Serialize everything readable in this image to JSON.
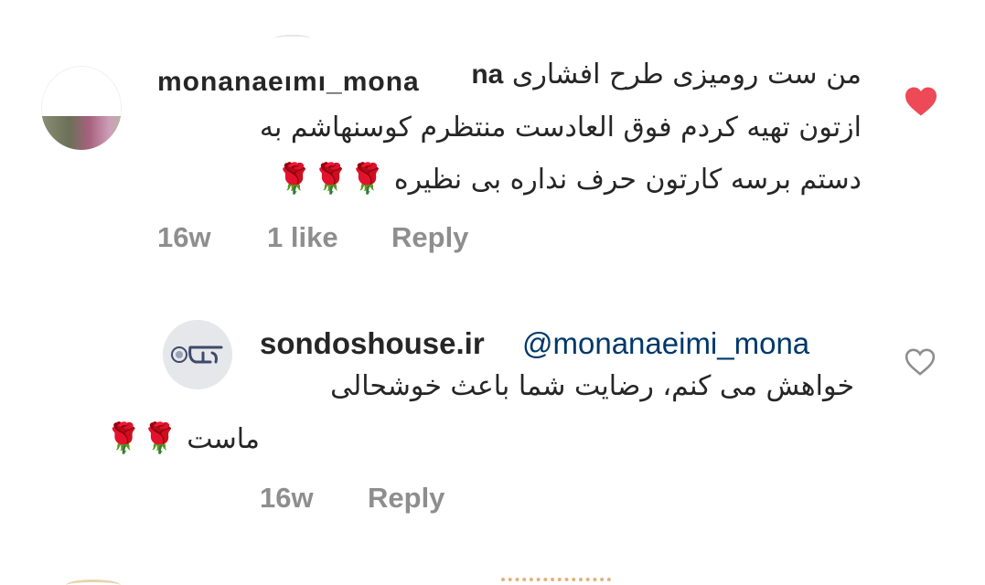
{
  "comment": {
    "username": "monanaeimi_mona",
    "username_inline_tail": "na",
    "lines": [
      "من ست رومیزی طرح افشاری",
      "ازتون تهیه کردم فوق العادست منتظرم کوسنهاشم به",
      "دستم برسه کارتون حرف نداره بی نظیره"
    ],
    "roses": "🌹🌹🌹",
    "time": "16w",
    "likes": "1 like",
    "reply_label": "Reply",
    "liked": true,
    "heart_color": "#ed4956"
  },
  "reply": {
    "username": "sondoshouse.ir",
    "mention": "@monanaeimi_mona",
    "lines": [
      "خواهش می کنم، رضایت شما باعث خوشحالی",
      "ماست"
    ],
    "roses": "🌹🌹",
    "time": "16w",
    "reply_label": "Reply",
    "liked": false,
    "mention_color": "#00376b"
  },
  "icons": {
    "like_filled": "heart-icon",
    "like_outline": "heart-outline-icon"
  }
}
